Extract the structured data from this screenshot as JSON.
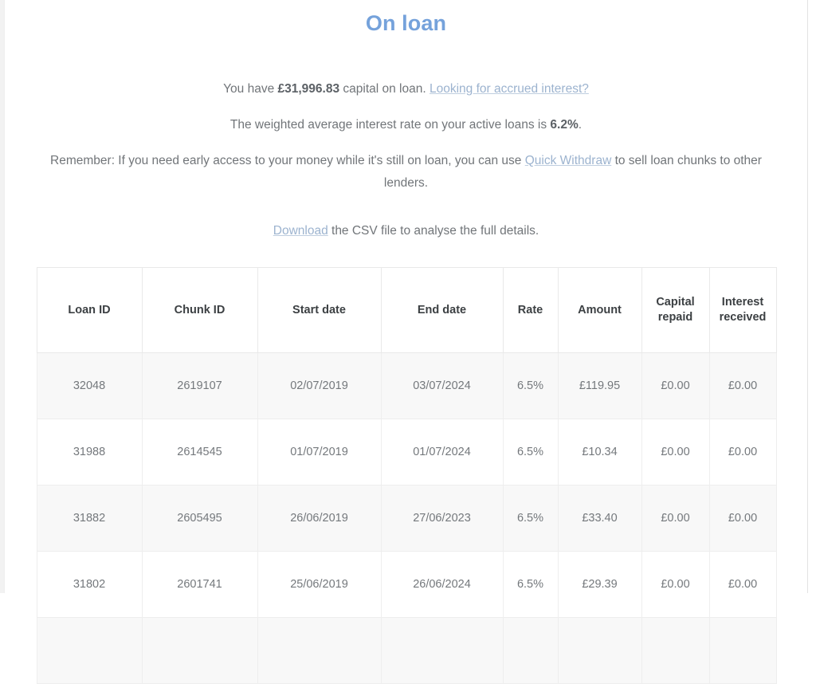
{
  "header": {
    "title": "On loan"
  },
  "intro": {
    "line1_pre": "You have ",
    "line1_amount": "£31,996.83",
    "line1_post": " capital on loan. ",
    "line1_link": "Looking for accrued interest?",
    "line2_pre": "The weighted average interest rate on your active loans is ",
    "line2_rate": "6.2%",
    "line2_post": ".",
    "line3_pre": "Remember: If you need early access to your money while it's still on loan, you can use ",
    "line3_link": "Quick Withdraw",
    "line3_post": " to sell loan chunks to other lenders.",
    "line4_link": "Download",
    "line4_post": " the CSV file to analyse the full details."
  },
  "table": {
    "columns": [
      "Loan ID",
      "Chunk ID",
      "Start date",
      "End date",
      "Rate",
      "Amount",
      "Capital repaid",
      "Interest received"
    ],
    "rows": [
      {
        "loan_id": "32048",
        "chunk_id": "2619107",
        "start_date": "02/07/2019",
        "end_date": "03/07/2024",
        "rate": "6.5%",
        "amount": "£119.95",
        "capital_repaid": "£0.00",
        "interest_received": "£0.00"
      },
      {
        "loan_id": "31988",
        "chunk_id": "2614545",
        "start_date": "01/07/2019",
        "end_date": "01/07/2024",
        "rate": "6.5%",
        "amount": "£10.34",
        "capital_repaid": "£0.00",
        "interest_received": "£0.00"
      },
      {
        "loan_id": "31882",
        "chunk_id": "2605495",
        "start_date": "26/06/2019",
        "end_date": "27/06/2023",
        "rate": "6.5%",
        "amount": "£33.40",
        "capital_repaid": "£0.00",
        "interest_received": "£0.00"
      },
      {
        "loan_id": "31802",
        "chunk_id": "2601741",
        "start_date": "25/06/2019",
        "end_date": "26/06/2024",
        "rate": "6.5%",
        "amount": "£29.39",
        "capital_repaid": "£0.00",
        "interest_received": "£0.00"
      },
      {
        "loan_id": "",
        "chunk_id": "",
        "start_date": "",
        "end_date": "",
        "rate": "",
        "amount": "",
        "capital_repaid": "",
        "interest_received": ""
      }
    ]
  },
  "colors": {
    "title": "#75a2db",
    "link": "#9cb3cf",
    "body_text": "#717579",
    "header_text": "#3c4043",
    "row_stripe": "#f8f8f8",
    "border": "#eeeeee"
  }
}
